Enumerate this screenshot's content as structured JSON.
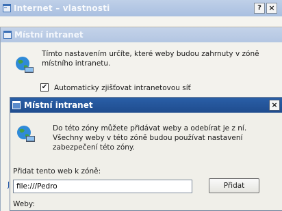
{
  "window_back": {
    "title": "Internet – vlastnosti",
    "help_label": "?",
    "close_label": "×"
  },
  "window_middle": {
    "title": "Místní intranet",
    "description": "Tímto nastavením určíte, které weby budou zahrnuty v zóně místního intranetu.",
    "auto_detect_label": "Automaticky zjišťovat intranetovou síť",
    "auto_detect_checked": true,
    "side_text": "Je"
  },
  "dialog": {
    "title": "Místní intranet",
    "close_label": "×",
    "description": "Do této zóny můžete přidávat weby a odebírat je z ní. Všechny weby v této zóně budou používat nastavení zabezpečení této zóny.",
    "add_site_label": "Přidat tento web k zóně:",
    "add_site_value": "file:///Pedro",
    "add_button_label": "Přidat",
    "websites_label": "Weby:"
  },
  "colors": {
    "active_title": "#2a5fa7",
    "inactive_title": "#b3c6e2"
  },
  "icons": [
    "window-icon",
    "globe-computer-icon",
    "checkmark-icon",
    "close-icon",
    "help-icon"
  ]
}
